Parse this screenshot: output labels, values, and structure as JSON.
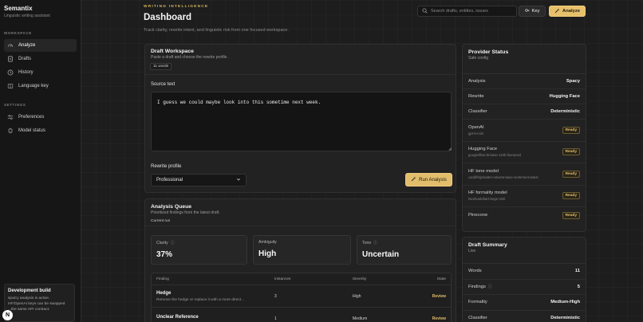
{
  "brand": {
    "title": "Semantix",
    "subtitle": "Linguistic writing assistant"
  },
  "sidebar": {
    "workspace_label": "WORKSPACE",
    "workspace_items": [
      {
        "label": "Analyze",
        "icon": "gauge-icon",
        "active": true
      },
      {
        "label": "Drafts",
        "icon": "document-icon"
      },
      {
        "label": "History",
        "icon": "clock-icon"
      },
      {
        "label": "Language key",
        "icon": "book-icon"
      }
    ],
    "settings_label": "SETTINGS",
    "settings_items": [
      {
        "label": "Preferences",
        "icon": "sliders-icon"
      },
      {
        "label": "Model status",
        "icon": "cpu-icon"
      }
    ],
    "dev": {
      "title": "Development build",
      "line1": "spaCy analysis is active.",
      "line2": "HF/OpenAI keys can be swapped",
      "line3": "...the same API contract."
    },
    "badge": "N"
  },
  "header": {
    "eyebrow": "WRITING INTELLIGENCE",
    "title": "Dashboard",
    "description": "Track clarity, rewrite intent, and linguistic risk from one focused workspace.",
    "search_placeholder": "Search drafts, entities, issues",
    "key_label": "Key",
    "analyze_label": "Analyze"
  },
  "draft": {
    "title": "Draft Workspace",
    "subtitle": "Paste a draft and choose the rewrite profile.",
    "word_count": "11 words",
    "source_label": "Source text",
    "source_text": "I guess we could maybe look into this sometime next week.",
    "rewrite_label": "Rewrite profile",
    "profile": "Professional",
    "run_label": "Run Analysis"
  },
  "queue": {
    "title": "Analysis Queue",
    "subtitle": "Prioritized findings from the latest draft.",
    "run_label": "Current run",
    "metrics": [
      {
        "label": "Clarity",
        "value": "37%",
        "info": true
      },
      {
        "label": "Ambiguity",
        "value": "High",
        "info": false
      },
      {
        "label": "Tone",
        "value": "Uncertain",
        "info": true
      }
    ],
    "columns": [
      "Finding",
      "Instances",
      "Severity",
      "State"
    ],
    "rows": [
      {
        "name": "Hedge",
        "desc": "Remove the hedge or replace it with a more direct...",
        "instances": "3",
        "severity": "High",
        "state": "Review"
      },
      {
        "name": "Unclear Reference",
        "desc": "",
        "instances": "1",
        "severity": "Medium",
        "state": "Review"
      }
    ]
  },
  "provider": {
    "title": "Provider Status",
    "subtitle": "Safe config",
    "rows": [
      {
        "name": "Analysis",
        "value": "Spacy"
      },
      {
        "name": "Rewrite",
        "value": "Hugging Face"
      },
      {
        "name": "Classifier",
        "value": "Deterministic"
      },
      {
        "name": "OpenAI",
        "model": "gpt-5-mini",
        "status": "Ready"
      },
      {
        "name": "Hugging Face",
        "model": "google/flan-t5-base-110k-finetuned",
        "status": "Ready"
      },
      {
        "name": "HF tone model",
        "model": "cardiffnlp/twitter-roberta-base-sentiment-latest",
        "status": "Ready"
      },
      {
        "name": "HF formality model",
        "model": "facebook/bart-large-mnli",
        "status": "Ready"
      },
      {
        "name": "Pinecone",
        "model": "",
        "status": "Ready"
      }
    ]
  },
  "summary": {
    "title": "Draft Summary",
    "subtitle": "Live",
    "rows": [
      {
        "label": "Words",
        "value": "11",
        "info": false
      },
      {
        "label": "Findings",
        "value": "5",
        "info": true
      },
      {
        "label": "Formality",
        "value": "Medium-High",
        "info": false
      },
      {
        "label": "Classifier",
        "value": "Deterministic",
        "info": false
      }
    ]
  },
  "colors": {
    "accent": "#e7c06c",
    "background": "#1b1b1b",
    "panel": "#222222"
  }
}
